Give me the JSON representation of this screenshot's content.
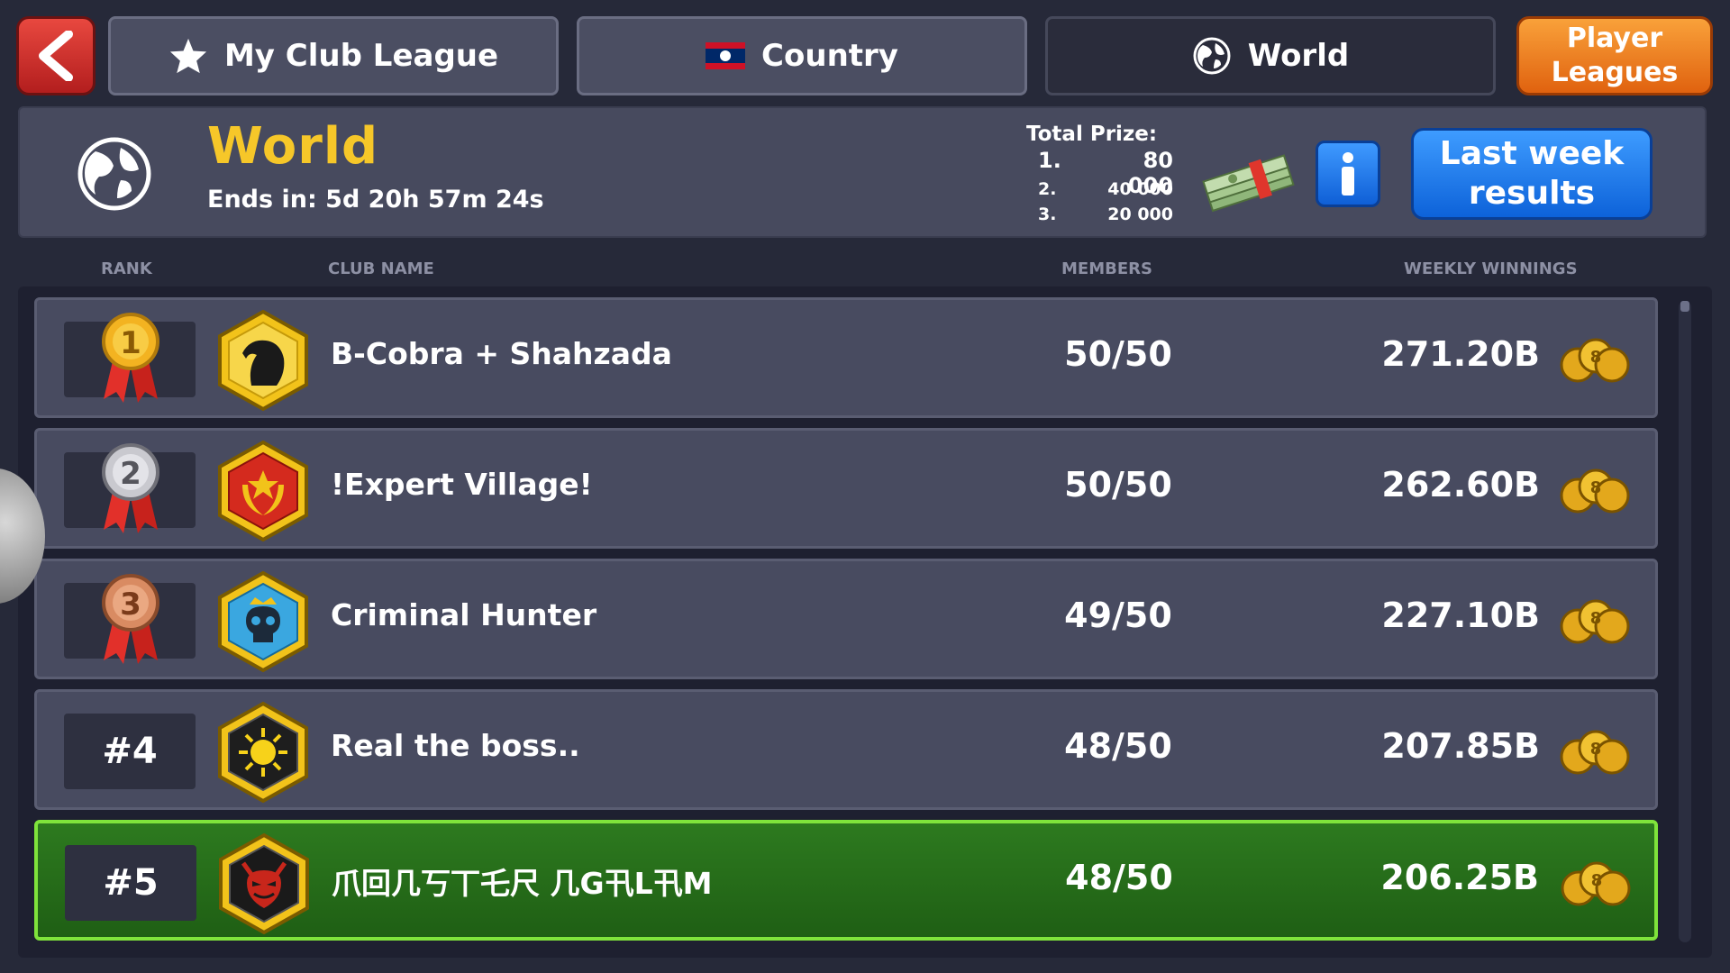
{
  "top_bar": {
    "back_label": "back",
    "tabs": [
      {
        "label": "My Club League",
        "icon": "star-icon"
      },
      {
        "label": "Country",
        "icon": "laos-flag-icon"
      },
      {
        "label": "World",
        "icon": "globe-icon"
      }
    ],
    "active_tab": "World",
    "player_leagues_label": "Player\nLeagues"
  },
  "league": {
    "title": "World",
    "ends_label": "Ends in:",
    "ends_value": "5d 20h 57m 24s",
    "prize_title": "Total Prize:",
    "prizes": [
      {
        "place": "1.",
        "amount": "80 000"
      },
      {
        "place": "2.",
        "amount": "40 000"
      },
      {
        "place": "3.",
        "amount": "20 000"
      }
    ],
    "last_week_label": "Last week results"
  },
  "columns": {
    "rank": "RANK",
    "club_name": "CLUB NAME",
    "members": "MEMBERS",
    "weekly_winnings": "WEEKLY WINNINGS"
  },
  "rows": [
    {
      "rank": "1",
      "rank_display": "medal",
      "medal": "gold",
      "badge": "horse-badge",
      "badge_color": "#f2c31a",
      "name": "B-Cobra + Shahzada",
      "members": "50/50",
      "winnings": "271.20B",
      "highlight": false
    },
    {
      "rank": "2",
      "rank_display": "medal",
      "medal": "silver",
      "badge": "laurel-badge",
      "badge_color": "#d42a1e",
      "name": "!Expert Village!",
      "members": "50/50",
      "winnings": "262.60B",
      "highlight": false
    },
    {
      "rank": "3",
      "rank_display": "medal",
      "medal": "bronze",
      "badge": "skull-badge",
      "badge_color": "#3aa7e0",
      "name": "Criminal Hunter",
      "members": "49/50",
      "winnings": "227.10B",
      "highlight": false
    },
    {
      "rank": "#4",
      "rank_display": "text",
      "badge": "sun-badge",
      "badge_color": "#1e1e1e",
      "name": "Real the boss..",
      "members": "48/50",
      "winnings": "207.85B",
      "highlight": false
    },
    {
      "rank": "#5",
      "rank_display": "text",
      "badge": "devil-badge",
      "badge_color": "#c8261b",
      "name": "爪回几丂丅乇尺 几G卂L卂M",
      "members": "48/50",
      "winnings": "206.25B",
      "highlight": true
    }
  ],
  "colors": {
    "title_yellow": "#f6c729",
    "highlight_green": "#2d7a1f",
    "highlight_border": "#7fe33b",
    "button_blue": "#1577ea",
    "button_orange": "#f08a25"
  }
}
